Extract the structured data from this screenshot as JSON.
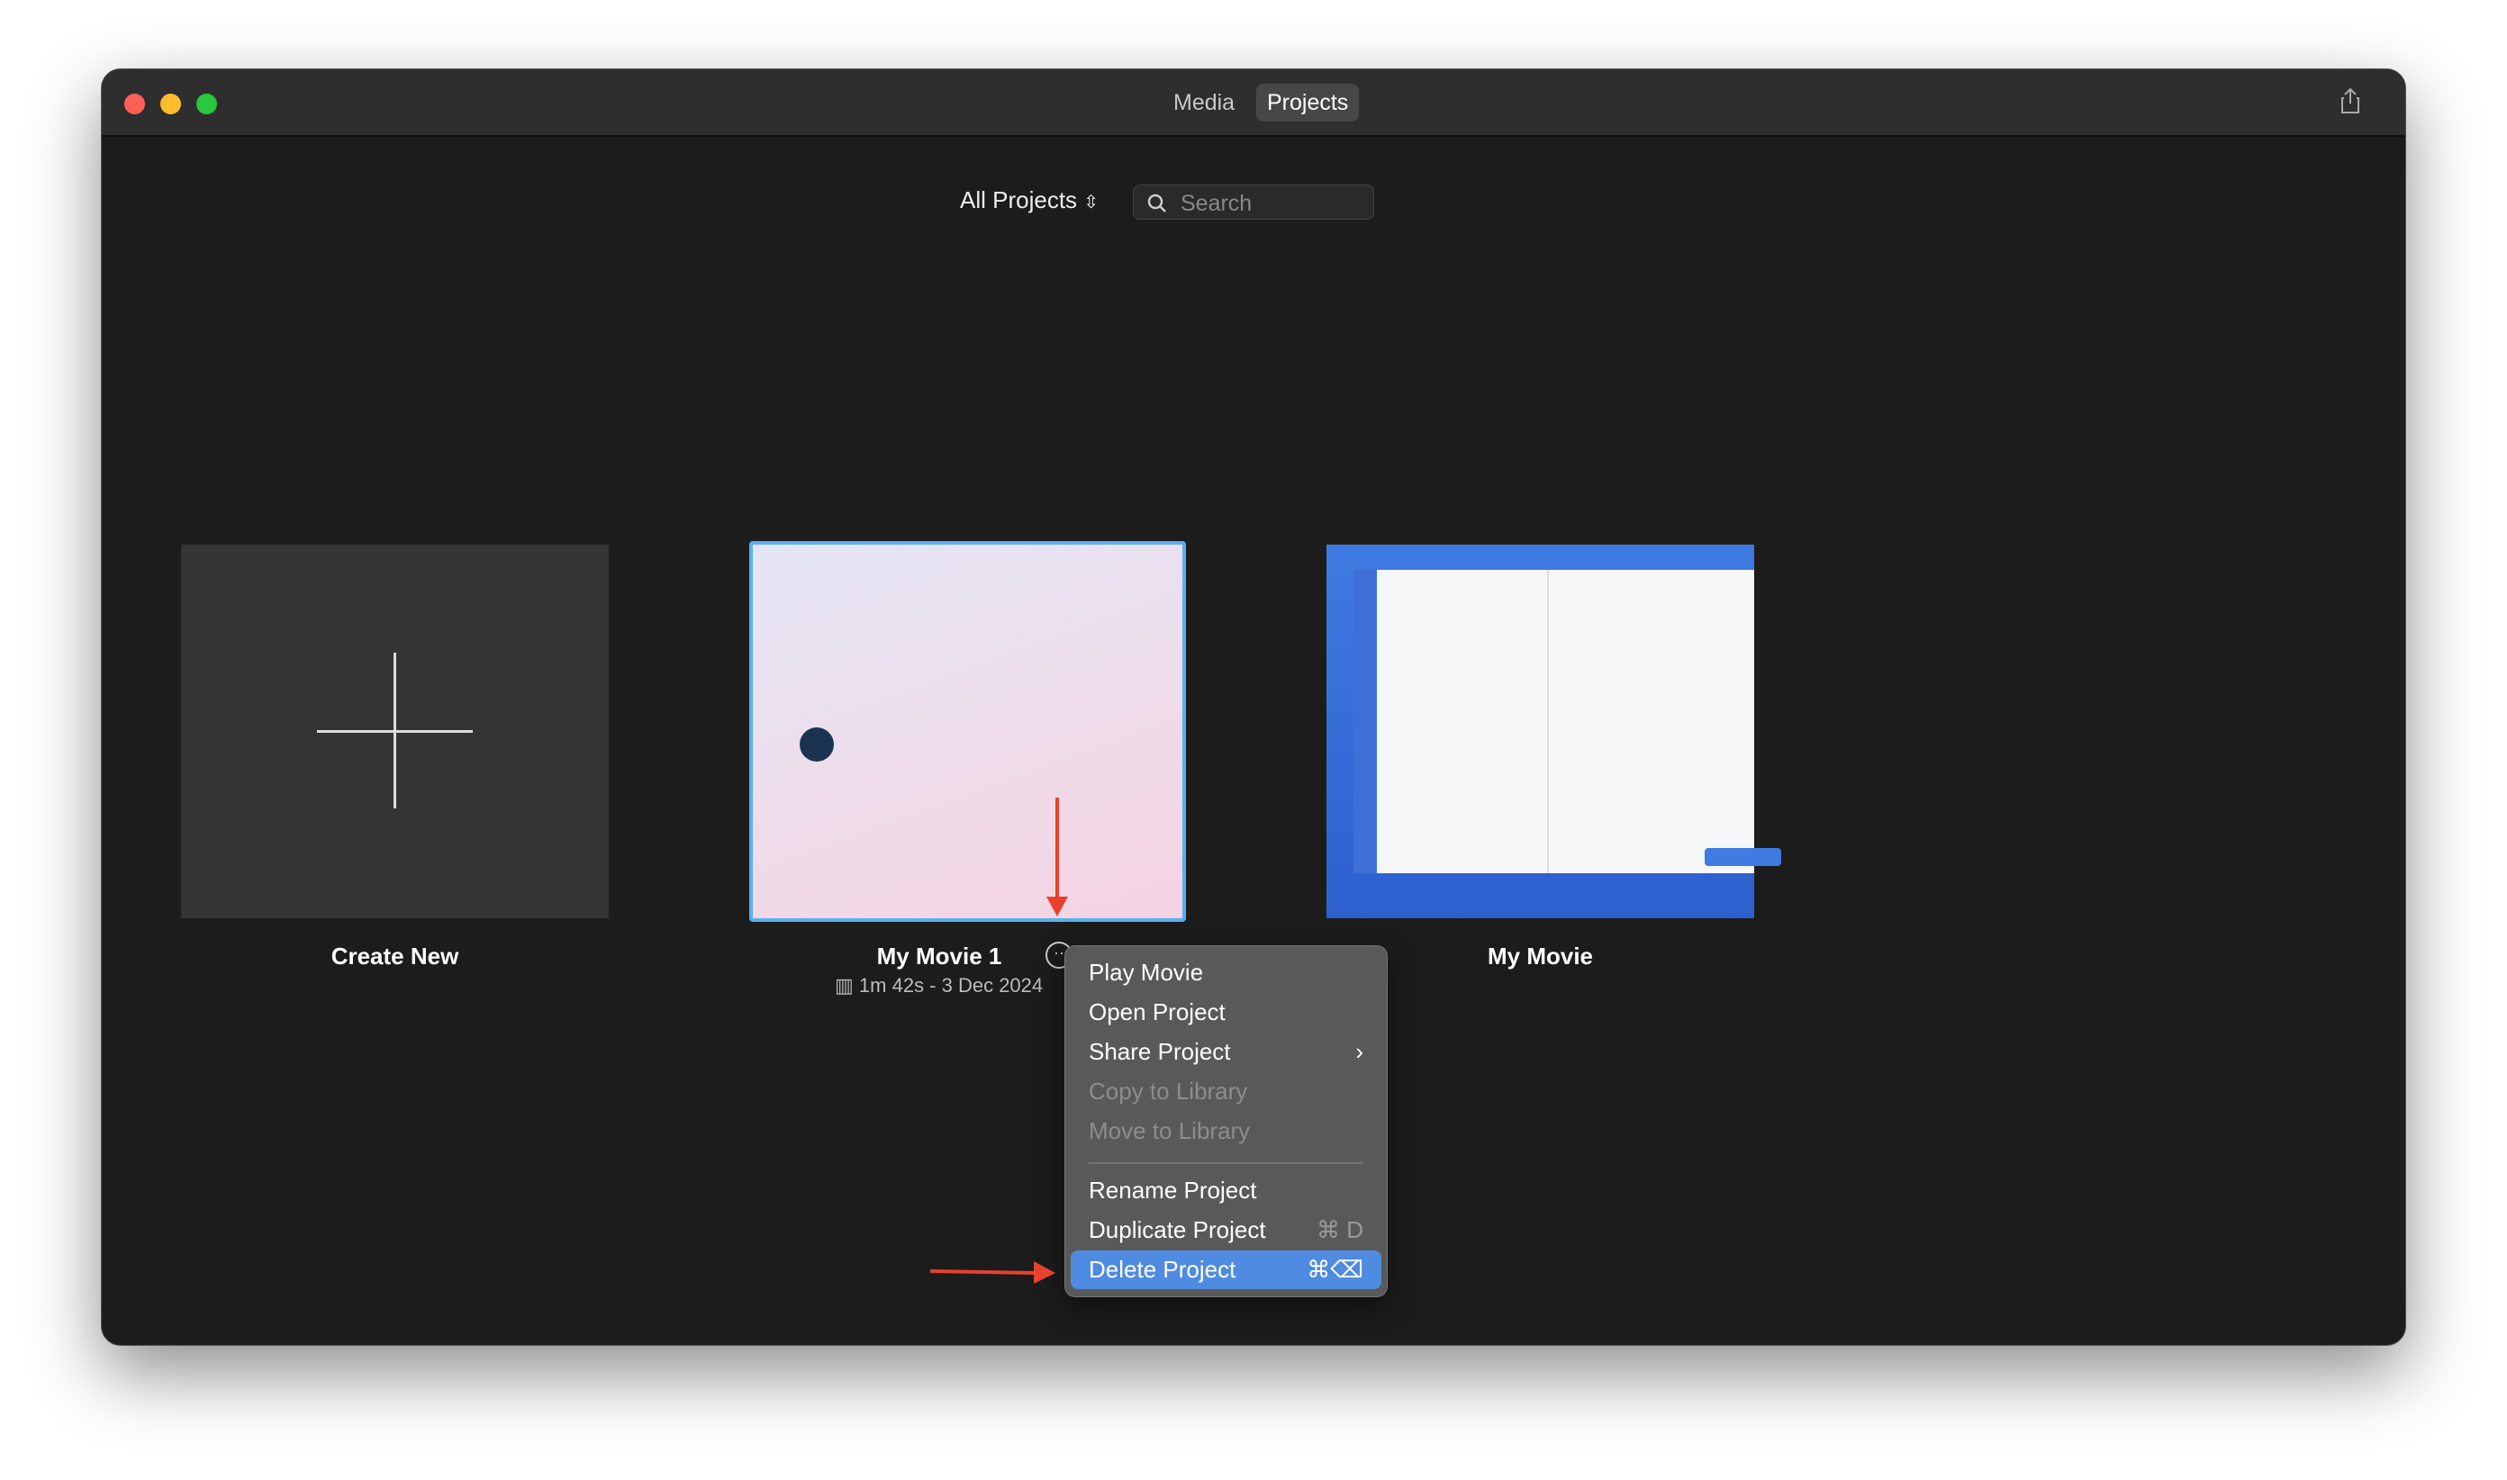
{
  "titlebar": {
    "tabs": [
      {
        "label": "Media",
        "active": false
      },
      {
        "label": "Projects",
        "active": true
      }
    ],
    "share_icon": "share-icon"
  },
  "toolbar": {
    "filter_label": "All Projects",
    "search_placeholder": "Search"
  },
  "projects": [
    {
      "label": "Create New",
      "type": "create"
    },
    {
      "label": "My Movie 1",
      "meta": "1m 42s - 3 Dec 2024",
      "selected": true
    },
    {
      "label": "My Movie"
    }
  ],
  "context_menu": {
    "items": [
      {
        "label": "Play Movie",
        "enabled": true
      },
      {
        "label": "Open Project",
        "enabled": true
      },
      {
        "label": "Share Project",
        "enabled": true,
        "submenu": true
      },
      {
        "label": "Copy to Library",
        "enabled": false
      },
      {
        "label": "Move to Library",
        "enabled": false
      },
      {
        "label": "Rename Project",
        "enabled": true
      },
      {
        "label": "Duplicate Project",
        "enabled": true,
        "shortcut": "⌘ D"
      },
      {
        "label": "Delete Project",
        "enabled": true,
        "shortcut": "⌘⌫",
        "highlighted": true
      }
    ]
  },
  "colors": {
    "accent": "#4f8be0",
    "annotation": "#e8412c",
    "selection_border": "#5ab0f0"
  }
}
